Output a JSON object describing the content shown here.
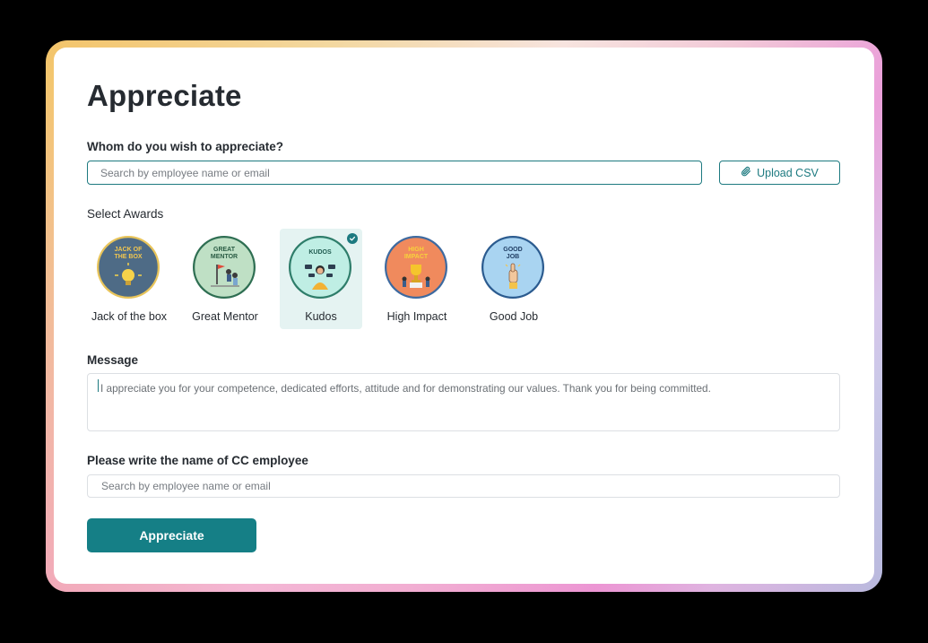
{
  "page": {
    "title": "Appreciate"
  },
  "recipient": {
    "label": "Whom do you wish to appreciate?",
    "placeholder": "Search by employee name or email",
    "upload_label": "Upload CSV"
  },
  "awards": {
    "label": "Select Awards",
    "items": [
      {
        "name": "Jack of the box",
        "badge_text": [
          "JACK OF",
          "THE BOX"
        ],
        "color": "#4e6b86",
        "ring": "#e8c45a",
        "text_color": "#f3c74f",
        "selected": false
      },
      {
        "name": "Great Mentor",
        "badge_text": [
          "GREAT",
          "MENTOR"
        ],
        "color": "#bfe0c5",
        "ring": "#2e6e52",
        "text_color": "#2a5c44",
        "selected": false
      },
      {
        "name": "Kudos",
        "badge_text": [
          "KUDOS"
        ],
        "color": "#bfeee4",
        "ring": "#2e7d6a",
        "text_color": "#1f5a4f",
        "selected": true
      },
      {
        "name": "High Impact",
        "badge_text": [
          "HIGH",
          "IMPACT"
        ],
        "color": "#f08a5d",
        "ring": "#3d6aa0",
        "text_color": "#f7d13c",
        "selected": false
      },
      {
        "name": "Good Job",
        "badge_text": [
          "GOOD",
          "JOB"
        ],
        "color": "#a9d4f1",
        "ring": "#2b5b8f",
        "text_color": "#1f3d63",
        "selected": false
      }
    ]
  },
  "message": {
    "label": "Message",
    "value": "I appreciate you for your competence, dedicated efforts, attitude and for demonstrating our values. Thank you for being committed."
  },
  "cc": {
    "label": "Please write the name of CC employee",
    "placeholder": "Search by employee name or email"
  },
  "submit": {
    "label": "Appreciate"
  },
  "colors": {
    "accent": "#157f86",
    "border": "#1d7a80",
    "selected_bg": "#e5f3f2"
  }
}
